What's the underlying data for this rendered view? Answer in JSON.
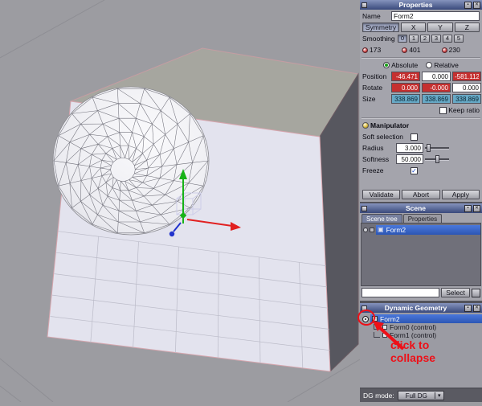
{
  "properties": {
    "title": "Properties",
    "name_label": "Name",
    "name_value": "Form2",
    "symmetry_button": "Symmetry",
    "axis_buttons": [
      "X",
      "Y",
      "Z"
    ],
    "smoothing_label": "Smoothing",
    "smoothing_levels": [
      "0",
      "1",
      "2",
      "3",
      "4",
      "5"
    ],
    "vertex_count": "173",
    "edge_count": "401",
    "face_count": "230",
    "absolute_label": "Absolute",
    "relative_label": "Relative",
    "position_label": "Position",
    "position_x": "-46.471",
    "position_y": "0.000",
    "position_z": "-581.112",
    "rotate_label": "Rotate",
    "rotate_x": "0.000",
    "rotate_y": "-0.000",
    "rotate_z": "0.000",
    "size_label": "Size",
    "size_x": "338.869",
    "size_y": "338.869",
    "size_z": "338.869",
    "keep_ratio_label": "Keep ratio",
    "manipulator_label": "Manipulator",
    "soft_selection_label": "Soft selection",
    "radius_label": "Radius",
    "radius_value": "3.000",
    "softness_label": "Softness",
    "softness_value": "50.000",
    "freeze_label": "Freeze",
    "validate_button": "Validate",
    "abort_button": "Abort",
    "apply_button": "Apply"
  },
  "scene": {
    "title": "Scene",
    "tab_scene_tree": "Scene tree",
    "tab_properties": "Properties",
    "item": "Form2",
    "search_value": "",
    "select_button": "Select"
  },
  "dynamic_geometry": {
    "title": "Dynamic Geometry",
    "items": [
      "Form2",
      "Form0 (control)",
      "Form1 (control)"
    ]
  },
  "footer": {
    "dg_mode_label": "DG mode:",
    "dg_mode_value": "Full DG"
  },
  "annotation": {
    "line1": "click to",
    "line2": "collapse"
  },
  "icons": {
    "shade": "▪",
    "close": "✕",
    "cube": "▣",
    "collapse": "−",
    "check": "✓",
    "dropdown_arrow": "▾"
  },
  "colors": {
    "selection_highlight": "#3a68d0",
    "field_negative": "#c53030",
    "field_size": "#67a9c6",
    "annotation_red": "#ee1018",
    "panel_titlebar": "#4a5a7c"
  }
}
